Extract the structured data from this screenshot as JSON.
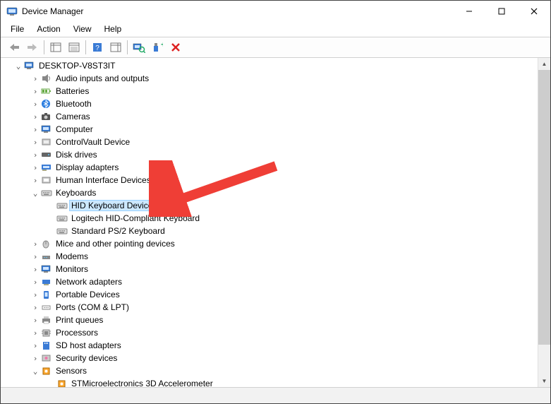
{
  "window": {
    "title": "Device Manager"
  },
  "menu": {
    "file": "File",
    "action": "Action",
    "view": "View",
    "help": "Help"
  },
  "tree": {
    "root": "DESKTOP-V8ST3IT",
    "nodes": {
      "audio": "Audio inputs and outputs",
      "batteries": "Batteries",
      "bluetooth": "Bluetooth",
      "cameras": "Cameras",
      "computer": "Computer",
      "controlvault": "ControlVault Device",
      "diskdrives": "Disk drives",
      "displayadapters": "Display adapters",
      "hid": "Human Interface Devices",
      "keyboards": "Keyboards",
      "kb_hid": "HID Keyboard Device",
      "kb_log": "Logitech HID-Compliant Keyboard",
      "kb_ps2": "Standard PS/2 Keyboard",
      "mice": "Mice and other pointing devices",
      "modems": "Modems",
      "monitors": "Monitors",
      "network": "Network adapters",
      "portable": "Portable Devices",
      "ports": "Ports (COM & LPT)",
      "printqueues": "Print queues",
      "processors": "Processors",
      "sdhost": "SD host adapters",
      "security": "Security devices",
      "sensors": "Sensors",
      "stm_accel": "STMicroelectronics 3D Accelerometer"
    }
  },
  "expanders": {
    "open": "⌄",
    "closed": "›"
  }
}
